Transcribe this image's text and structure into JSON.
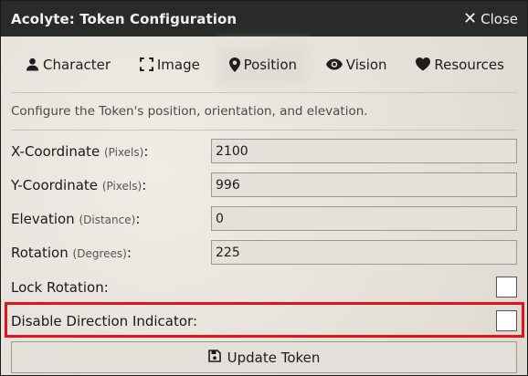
{
  "window": {
    "title": "Acolyte: Token Configuration",
    "close_label": "Close"
  },
  "tabs": [
    {
      "label": "Character",
      "icon": "user-icon",
      "active": false
    },
    {
      "label": "Image",
      "icon": "image-frame-icon",
      "active": false
    },
    {
      "label": "Position",
      "icon": "map-pin-icon",
      "active": true
    },
    {
      "label": "Vision",
      "icon": "eye-icon",
      "active": false
    },
    {
      "label": "Resources",
      "icon": "heart-icon",
      "active": false
    }
  ],
  "hint": "Configure the Token's position, orientation, and elevation.",
  "fields": {
    "x": {
      "label": "X-Coordinate",
      "unit": "(Pixels)",
      "value": "2100"
    },
    "y": {
      "label": "Y-Coordinate",
      "unit": "(Pixels)",
      "value": "996"
    },
    "elevation": {
      "label": "Elevation",
      "unit": "(Distance)",
      "value": "0"
    },
    "rotation": {
      "label": "Rotation",
      "unit": "(Degrees)",
      "value": "225"
    }
  },
  "checkboxes": {
    "lock_rotation": {
      "label": "Lock Rotation:",
      "checked": false
    },
    "disable_direction": {
      "label": "Disable Direction Indicator:",
      "checked": false
    }
  },
  "update_button": {
    "label": "Update Token"
  },
  "colors": {
    "highlight_border": "#e1141b",
    "titlebar": "#2a2a2a"
  }
}
